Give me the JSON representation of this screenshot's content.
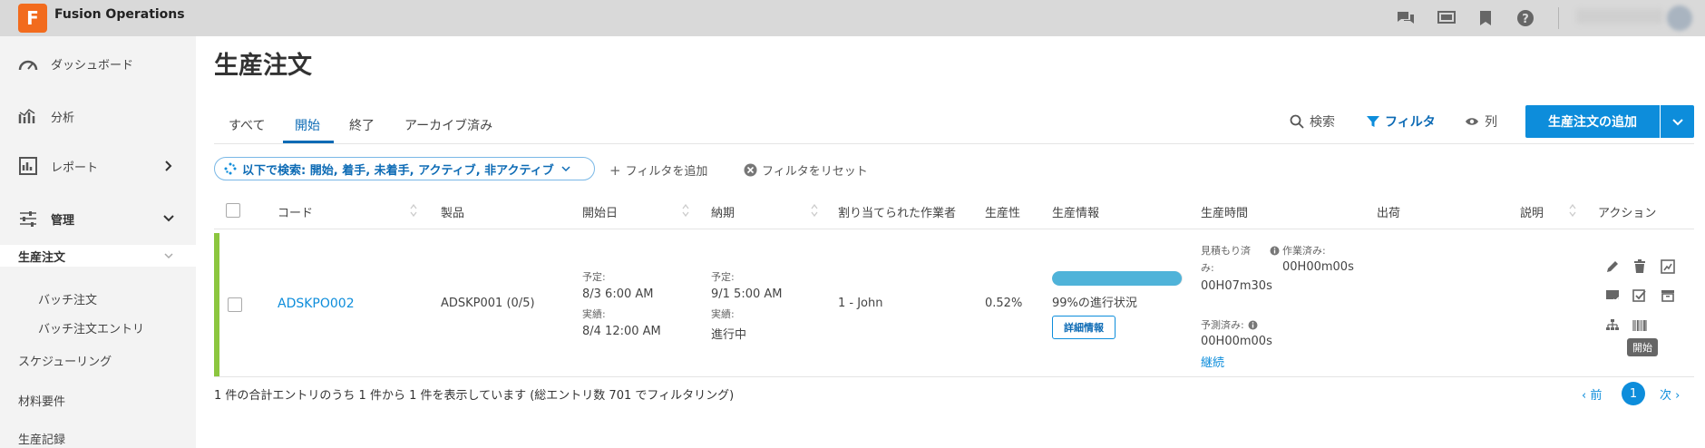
{
  "app": {
    "logo_letter": "F",
    "title": "Fusion Operations"
  },
  "topbar": {
    "icons": [
      "chat-icon",
      "monitor-icon",
      "bookmark-icon",
      "help-icon"
    ]
  },
  "sidebar": {
    "items": [
      {
        "label": "ダッシュボード",
        "icon": "dashboard-icon"
      },
      {
        "label": "分析",
        "icon": "analytics-icon"
      },
      {
        "label": "レポート",
        "icon": "report-icon"
      },
      {
        "label": "管理",
        "icon": "settings-sliders-icon"
      }
    ],
    "section": "生産注文",
    "sub_items": [
      "バッチ注文",
      "バッチ注文エントリ"
    ],
    "lower_items": [
      "スケジューリング",
      "材料要件",
      "生産記録"
    ]
  },
  "main": {
    "title": "生産注文",
    "tabs": [
      "すべて",
      "開始",
      "終了",
      "アーカイブ済み"
    ],
    "active_tab": "開始",
    "toolbar": {
      "search": "検索",
      "filter": "フィルタ",
      "columns": "列",
      "add": "生産注文の追加"
    },
    "filter_chip": "以下で検索: 開始, 着手, 未着手, アクティブ, 非アクティブ",
    "add_filter": "フィルタを追加",
    "reset_filter": "フィルタをリセット"
  },
  "table": {
    "headers": [
      "コード",
      "製品",
      "開始日",
      "納期",
      "割り当てられた作業者",
      "生産性",
      "生産情報",
      "生産時間",
      "出荷",
      "説明",
      "アクション"
    ],
    "row": {
      "code": "ADSKPO002",
      "product": "ADSKP001 (0/5)",
      "start_planned_label": "予定:",
      "start_planned": "8/3   6:00 AM",
      "start_actual_label": "実績:",
      "start_actual": "8/4   12:00 AM",
      "due_planned_label": "予定:",
      "due_planned": "9/1   5:00 AM",
      "due_actual_label": "実績:",
      "due_actual": "進行中",
      "worker": "1 - John",
      "productivity": "0.52%",
      "progress_percent": 99,
      "progress_text": "99%の進行状況",
      "detail_button": "詳細情報",
      "estimated_label": "見積もり済",
      "estimated_label2": "み:",
      "estimated_value": "00H07m30s",
      "worked_label": "作業済み:",
      "worked_value": "00H00m00s",
      "forecast_label": "予測済み:",
      "forecast_value": "00H00m00s",
      "continue_link": "継続"
    },
    "tooltip": "開始"
  },
  "footer": {
    "summary": "1 件の合計エントリのうち 1 件から 1 件を表示しています (総エントリ数 701 でフィルタリング)",
    "prev": "‹ 前",
    "page": "1",
    "next": "次 ›"
  },
  "colors": {
    "accent": "#0d8ddb",
    "row_status": "#8cc63f",
    "logo": "#f26b1d"
  }
}
